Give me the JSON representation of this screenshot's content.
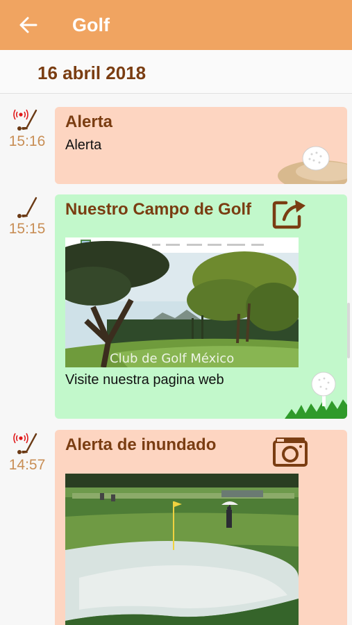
{
  "appbar": {
    "title": "Golf",
    "back_icon": "arrow-left-icon",
    "background": "#f0a461"
  },
  "date_header": {
    "label": "16 abril 2018"
  },
  "entries": [
    {
      "time": "15:16",
      "type_icon": "alert-golf-club-icon",
      "card_color": "#fdd5c1",
      "title": "Alerta",
      "text": "Alerta",
      "decoration": "golf-ball-in-sand-bunker"
    },
    {
      "time": "15:15",
      "type_icon": "golf-club-icon",
      "card_color": "#c2f8cb",
      "title": "Nuestro Campo de Golf",
      "action_icon": "external-link-icon",
      "image_caption": "Club de Golf México",
      "text": "Visite nuestra pagina web",
      "decoration": "golf-ball-on-tee-grass"
    },
    {
      "time": "14:57",
      "type_icon": "alert-golf-club-icon",
      "card_color": "#fdd5c1",
      "title": "Alerta de inundado",
      "action_icon": "camera-icon",
      "image": "flooded-golf-green-photo"
    }
  ],
  "colors": {
    "title_brown": "#7a3d12",
    "time_tan": "#c88e55",
    "alert_red": "#e0181a"
  }
}
